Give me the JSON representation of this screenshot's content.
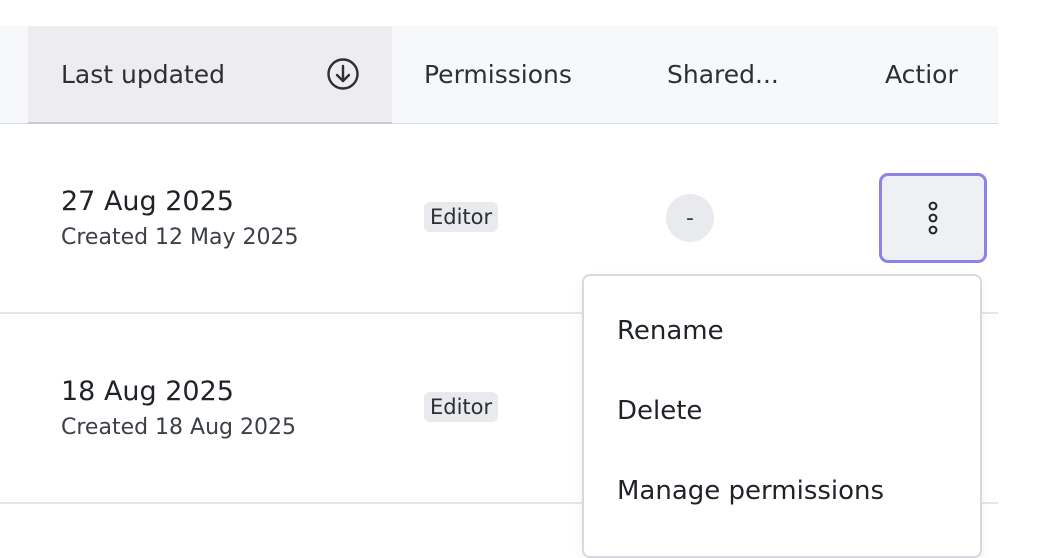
{
  "header": {
    "last_updated": "Last updated",
    "permissions": "Permissions",
    "shared": "Shared...",
    "action": "Actior"
  },
  "rows": [
    {
      "updated": "27 Aug 2025",
      "created": "Created 12 May 2025",
      "permission": "Editor",
      "shared": "-"
    },
    {
      "updated": "18 Aug 2025",
      "created": "Created 18 Aug 2025",
      "permission": "Editor"
    }
  ],
  "menu": {
    "items": [
      "Rename",
      "Delete",
      "Manage permissions"
    ]
  },
  "icons": {
    "sort": "arrow-down-circle-icon",
    "more": "more-vertical-icon"
  },
  "colors": {
    "focus_ring": "#8b83e6"
  }
}
